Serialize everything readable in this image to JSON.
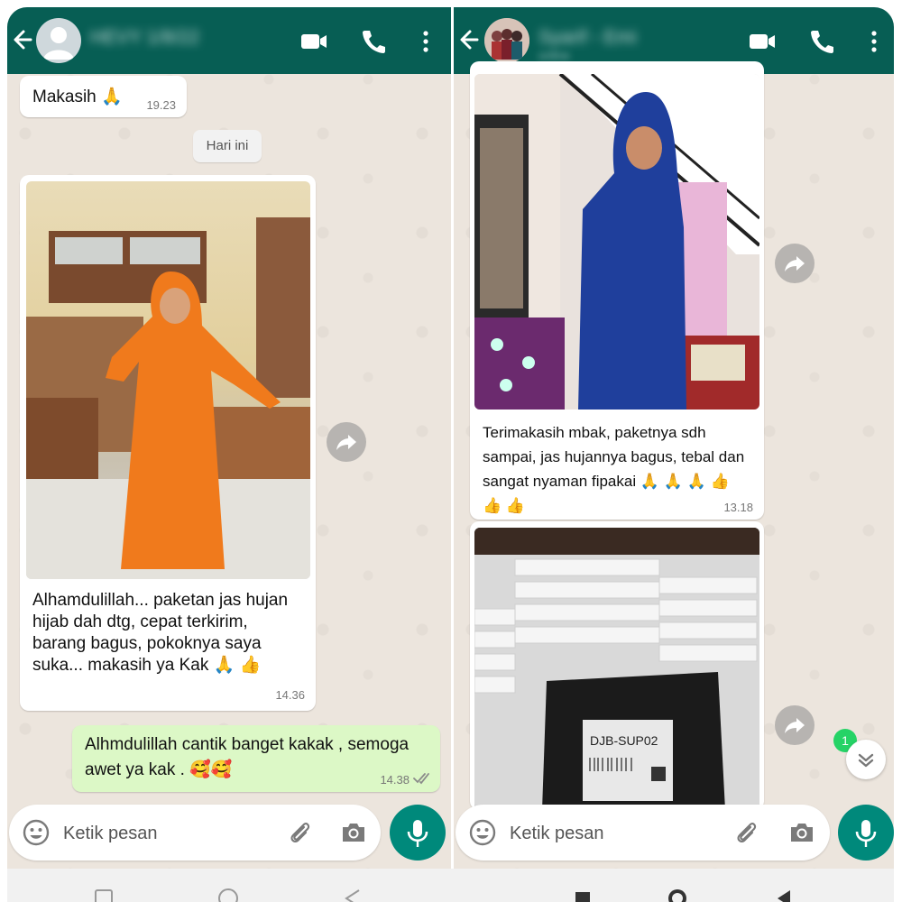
{
  "left_chat": {
    "contact_name": "HEVY 1/8/22",
    "messages": {
      "m1_text": "Makasih 🙏",
      "m1_time": "19.23",
      "date_chip": "Hari ini",
      "m2_text": "Alhamdulillah... paketan jas hujan\nhijab dah dtg, cepat terkirim,\nbarang bagus, pokoknya saya\nsuka... makasih ya Kak 🙏 👍",
      "m2_time": "14.36",
      "m3_text": "Alhmdulillah cantik banget kakak , semoga\nawet ya kak . 🥰🥰",
      "m3_time": "14.38"
    },
    "composer_placeholder": "Ketik pesan"
  },
  "right_chat": {
    "contact_name": "Syarif - Emi",
    "contact_sub": "online",
    "messages": {
      "m1_text": "Terimakasih mbak, paketnya sdh\nsampai, jas hujannya bagus, tebal dan\nsangat nyaman fipakai 🙏 🙏 🙏 👍\n👍 👍",
      "m1_time": "13.18",
      "package_label": "DJB-SUP02"
    },
    "unread_count": "1",
    "composer_placeholder": "Ketik pesan"
  },
  "colors": {
    "header": "#075e54",
    "outgoing_bubble": "#dcf8c6",
    "incoming_bubble": "#ffffff",
    "mic_button": "#00897b",
    "unread_badge": "#25d366",
    "read_ticks": "#8a8a8a"
  },
  "icons": {
    "header": [
      "back-arrow",
      "video-call",
      "voice-call",
      "more-vertical"
    ],
    "composer": [
      "emoji",
      "attach",
      "camera",
      "mic"
    ],
    "bubbles": [
      "forward-share",
      "double-check",
      "chevron-down"
    ]
  }
}
